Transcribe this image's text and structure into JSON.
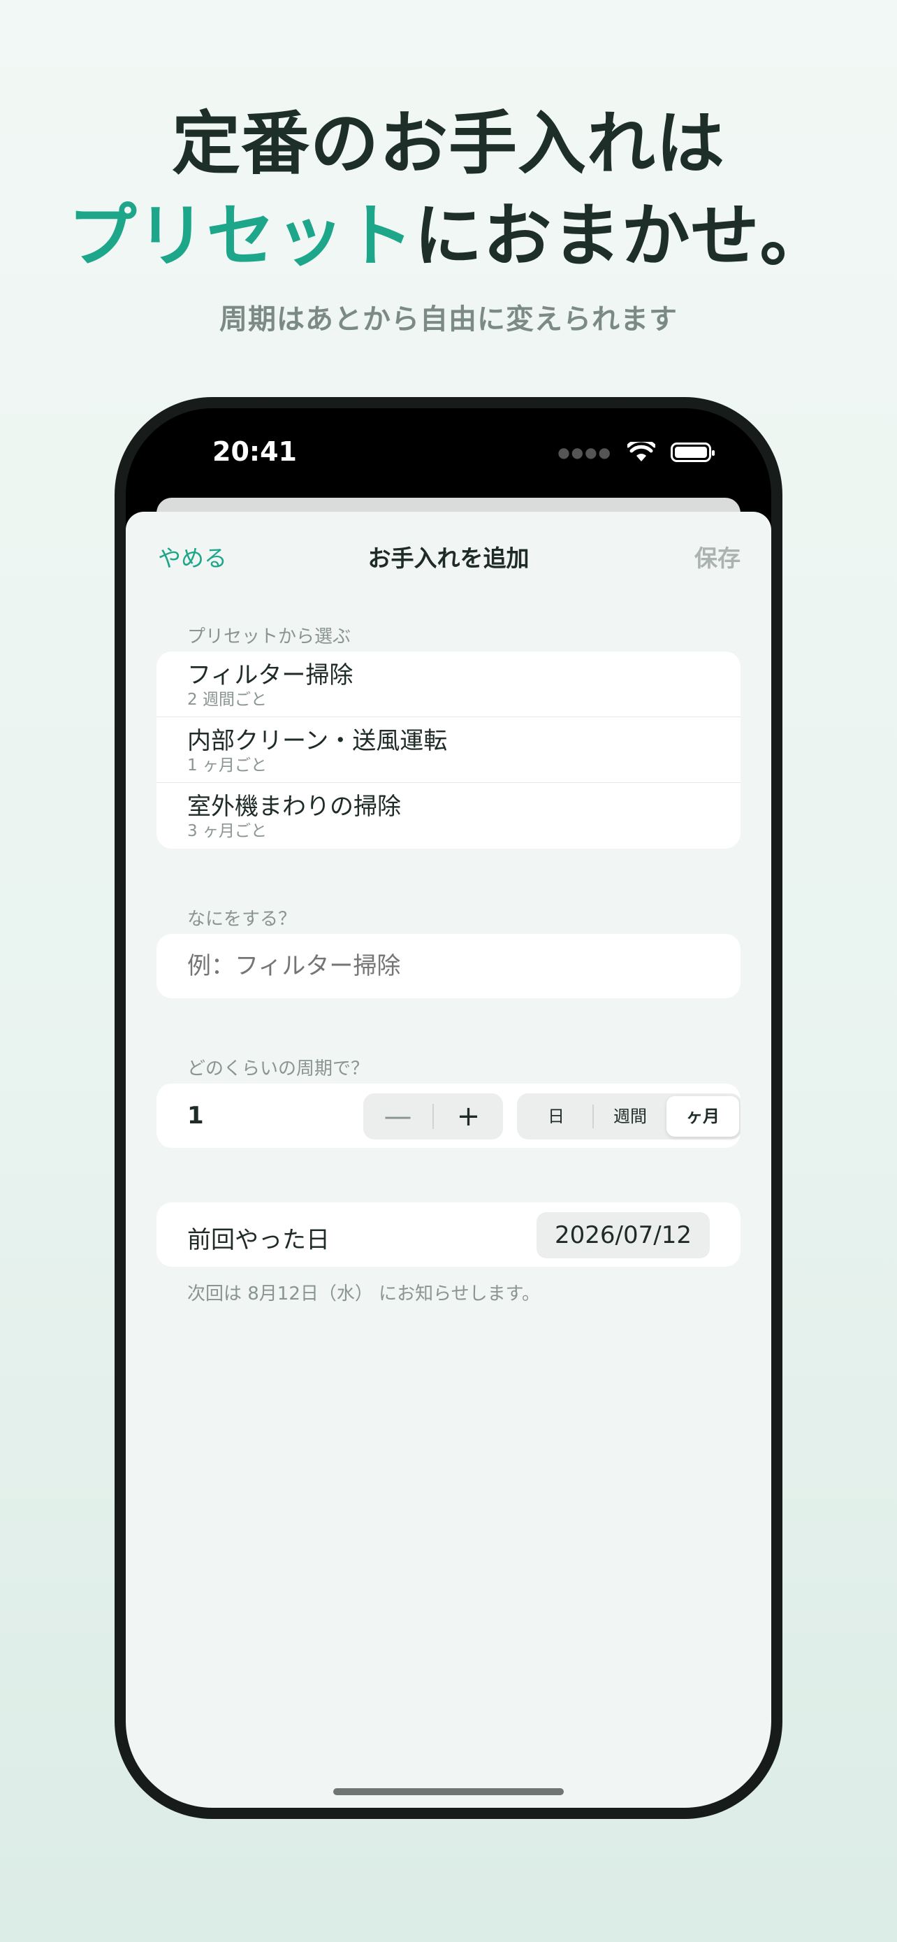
{
  "promo": {
    "headline_line1": "定番のお手入れは",
    "headline_accent": "プリセット",
    "headline_line2_rest": "におまかせ。",
    "subheadline": "周期はあとから自由に変えられます"
  },
  "status_bar": {
    "time": "20:41"
  },
  "nav": {
    "cancel_label": "やめる",
    "title": "お手入れを追加",
    "save_label": "保存"
  },
  "presets": {
    "section_label": "プリセットから選ぶ",
    "items": [
      {
        "title": "フィルター掃除",
        "interval": "2 週間ごと"
      },
      {
        "title": "内部クリーン・送風運転",
        "interval": "1 ヶ月ごと"
      },
      {
        "title": "室外機まわりの掃除",
        "interval": "3 ヶ月ごと"
      }
    ]
  },
  "task": {
    "section_label": "なにをする？",
    "value": "",
    "placeholder": "例：フィルター掃除"
  },
  "frequency": {
    "section_label": "どのくらいの周期で？",
    "count": "1",
    "minus_label": "—",
    "plus_label": "+",
    "units": [
      "日",
      "週間",
      "ヶ月"
    ],
    "selected_unit": "ヶ月"
  },
  "last_done": {
    "label": "前回やった日",
    "date": "2026/07/12",
    "next_notice": "次回は 8月12日（水） にお知らせします。"
  },
  "colors": {
    "accent": "#1ea68a",
    "text_primary": "#1f2b27",
    "text_secondary": "#8a9591"
  }
}
